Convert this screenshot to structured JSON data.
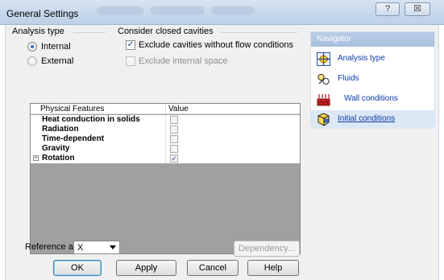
{
  "window": {
    "title": "General Settings",
    "help_glyph": "?",
    "close_glyph": "☒"
  },
  "analysis_type": {
    "group_label": "Analysis type",
    "options": [
      {
        "label": "Internal",
        "selected": true
      },
      {
        "label": "External",
        "selected": false
      }
    ]
  },
  "closed_cavities": {
    "group_label": "Consider closed cavities",
    "exclude_no_flow": {
      "label": "Exclude cavities without flow conditions",
      "checked": true
    },
    "exclude_internal": {
      "label": "Exclude internal space",
      "checked": false,
      "enabled": false
    }
  },
  "features_table": {
    "headers": [
      "Physical Features",
      "Value"
    ],
    "rows": [
      {
        "name": "Heat conduction in solids",
        "checked": false,
        "expandable": false
      },
      {
        "name": "Radiation",
        "checked": false,
        "expandable": false
      },
      {
        "name": "Time-dependent",
        "checked": false,
        "expandable": false
      },
      {
        "name": "Gravity",
        "checked": false,
        "expandable": false
      },
      {
        "name": "Rotation",
        "checked": true,
        "expandable": true
      }
    ]
  },
  "reference_axis": {
    "label": "Reference axis:",
    "value": "X"
  },
  "buttons": {
    "dependency": "Dependency...",
    "ok": "OK",
    "apply": "Apply",
    "cancel": "Cancel",
    "help": "Help"
  },
  "navigator": {
    "title": "Navigator",
    "items": [
      {
        "label": "Analysis type",
        "icon": "analysis-type-icon",
        "selected": false
      },
      {
        "label": "Fluids",
        "icon": "fluids-icon",
        "selected": false
      },
      {
        "label": "Wall conditions",
        "icon": "wall-conditions-icon",
        "selected": false
      },
      {
        "label": "Initial conditions",
        "icon": "initial-conditions-icon",
        "selected": true
      }
    ]
  },
  "colors": {
    "accent": "#0b39a8",
    "navigator_header": "#a8c0de",
    "table_empty_area": "#a0a0a0"
  }
}
